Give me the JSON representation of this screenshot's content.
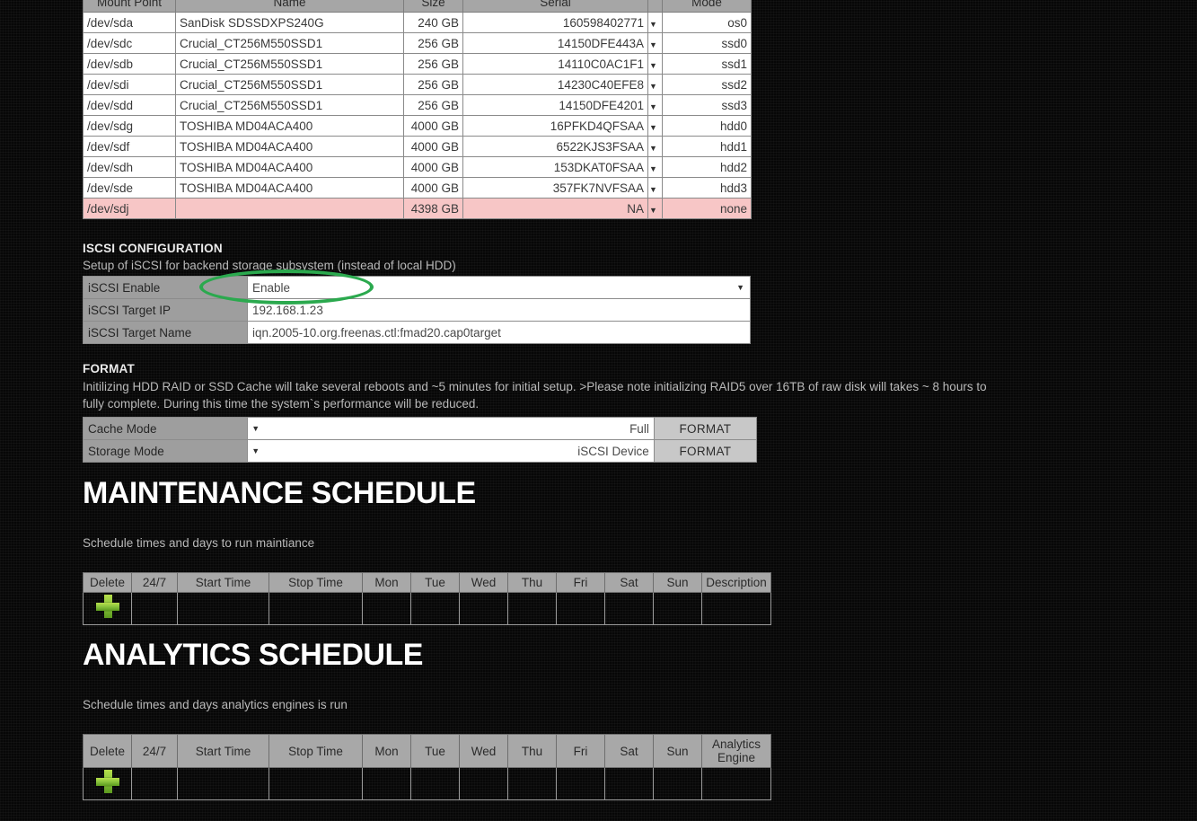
{
  "disk_table": {
    "headers": [
      "Mount Point",
      "Name",
      "Size",
      "Serial",
      "Mode"
    ],
    "rows": [
      {
        "mount": "/dev/sda",
        "name": "SanDisk SDSSDXPS240G",
        "size": "240 GB",
        "serial": "160598402771",
        "mode": "os0",
        "alert": false
      },
      {
        "mount": "/dev/sdc",
        "name": "Crucial_CT256M550SSD1",
        "size": "256 GB",
        "serial": "14150DFE443A",
        "mode": "ssd0",
        "alert": false
      },
      {
        "mount": "/dev/sdb",
        "name": "Crucial_CT256M550SSD1",
        "size": "256 GB",
        "serial": "14110C0AC1F1",
        "mode": "ssd1",
        "alert": false
      },
      {
        "mount": "/dev/sdi",
        "name": "Crucial_CT256M550SSD1",
        "size": "256 GB",
        "serial": "14230C40EFE8",
        "mode": "ssd2",
        "alert": false
      },
      {
        "mount": "/dev/sdd",
        "name": "Crucial_CT256M550SSD1",
        "size": "256 GB",
        "serial": "14150DFE4201",
        "mode": "ssd3",
        "alert": false
      },
      {
        "mount": "/dev/sdg",
        "name": "TOSHIBA MD04ACA400",
        "size": "4000 GB",
        "serial": "16PFKD4QFSAA",
        "mode": "hdd0",
        "alert": false
      },
      {
        "mount": "/dev/sdf",
        "name": "TOSHIBA MD04ACA400",
        "size": "4000 GB",
        "serial": "6522KJS3FSAA",
        "mode": "hdd1",
        "alert": false
      },
      {
        "mount": "/dev/sdh",
        "name": "TOSHIBA MD04ACA400",
        "size": "4000 GB",
        "serial": "153DKAT0FSAA",
        "mode": "hdd2",
        "alert": false
      },
      {
        "mount": "/dev/sde",
        "name": "TOSHIBA MD04ACA400",
        "size": "4000 GB",
        "serial": "357FK7NVFSAA",
        "mode": "hdd3",
        "alert": false
      },
      {
        "mount": "/dev/sdj",
        "name": "",
        "size": "4398 GB",
        "serial": "NA",
        "mode": "none",
        "alert": true
      }
    ],
    "alert_row_color": "#f7c6c6"
  },
  "iscsi": {
    "title": "ISCSI CONFIGURATION",
    "subtitle": "Setup of iSCSI for backend storage subsystem (instead of local HDD)",
    "enable_label": "iSCSI Enable",
    "enable_value": "Enable",
    "target_ip_label": "iSCSI Target IP",
    "target_ip_value": "192.168.1.23",
    "target_name_label": "iSCSI Target Name",
    "target_name_value": "iqn.2005-10.org.freenas.ctl:fmad20.cap0target",
    "highlight_color": "#2ba94e"
  },
  "format": {
    "title": "FORMAT",
    "description": "Initilizing HDD RAID or SSD Cache will take several reboots and ~5 minutes for initial setup. >Please note initializing RAID5 over 16TB of raw disk will takes ~ 8 hours to fully complete. During this time the system`s performance will be reduced.",
    "cache_label": "Cache Mode",
    "cache_value": "Full",
    "cache_button": "FORMAT",
    "storage_label": "Storage Mode",
    "storage_value": "iSCSI Device",
    "storage_button": "FORMAT"
  },
  "maintenance": {
    "heading": "MAINTENANCE SCHEDULE",
    "description": "Schedule times and days to run maintiance",
    "headers": [
      "Delete",
      "24/7",
      "Start Time",
      "Stop Time",
      "Mon",
      "Tue",
      "Wed",
      "Thu",
      "Fri",
      "Sat",
      "Sun",
      "Description"
    ],
    "add_icon": "plus-icon"
  },
  "analytics": {
    "heading": "ANALYTICS SCHEDULE",
    "description": "Schedule times and days analytics engines is run",
    "headers": [
      "Delete",
      "24/7",
      "Start Time",
      "Stop Time",
      "Mon",
      "Tue",
      "Wed",
      "Thu",
      "Fri",
      "Sat",
      "Sun",
      "Analytics Engine"
    ],
    "add_icon": "plus-icon"
  }
}
